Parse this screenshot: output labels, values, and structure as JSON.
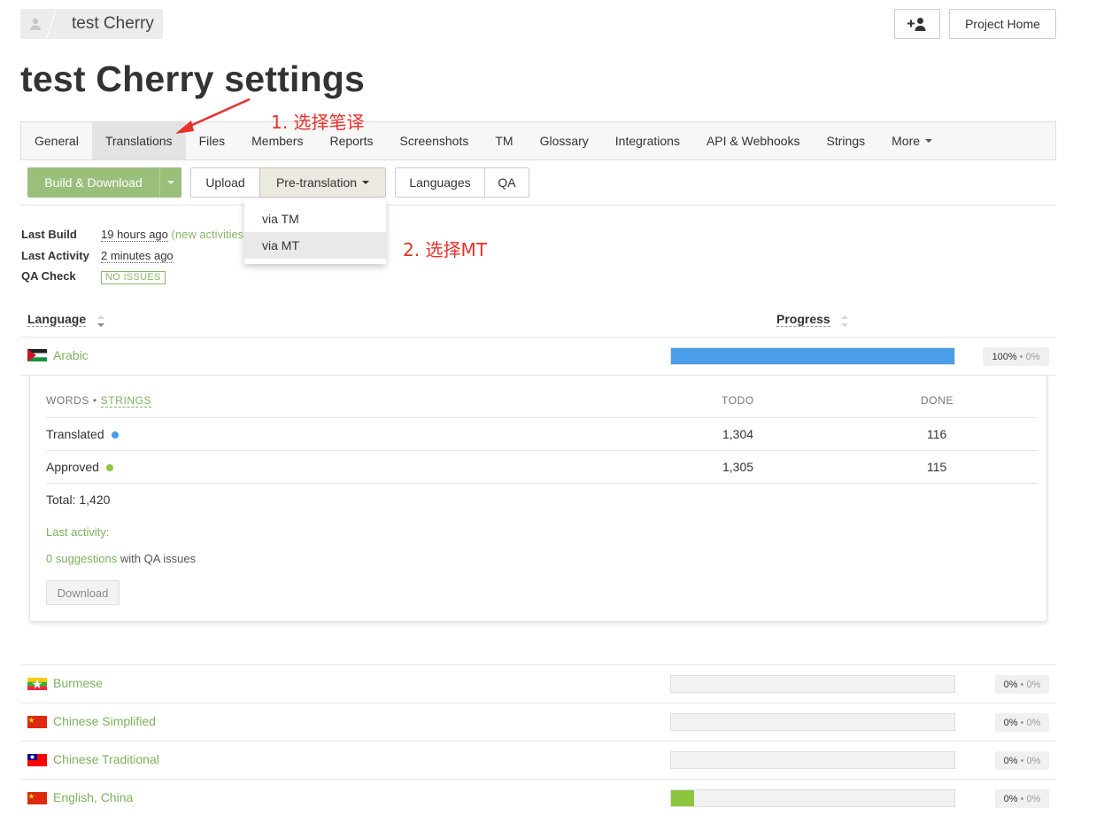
{
  "header": {
    "project_name": "test Cherry",
    "add_member_icon": "add-user-icon",
    "project_home_label": "Project Home"
  },
  "page_title": "test Cherry settings",
  "tabs": [
    {
      "label": "General"
    },
    {
      "label": "Translations",
      "active": true
    },
    {
      "label": "Files"
    },
    {
      "label": "Members"
    },
    {
      "label": "Reports"
    },
    {
      "label": "Screenshots"
    },
    {
      "label": "TM"
    },
    {
      "label": "Glossary"
    },
    {
      "label": "Integrations"
    },
    {
      "label": "API & Webhooks"
    },
    {
      "label": "Strings"
    },
    {
      "label": "More"
    }
  ],
  "toolbar": {
    "build_label": "Build & Download",
    "upload_label": "Upload",
    "pretranslation_label": "Pre-translation",
    "languages_label": "Languages",
    "qa_label": "QA"
  },
  "pretranslation_menu": {
    "items": [
      "via TM",
      "via MT"
    ],
    "hovered": "via MT"
  },
  "annotations": {
    "step1": "1. 选择笔译",
    "step2": "2. 选择MT"
  },
  "meta": {
    "last_build_key": "Last Build",
    "last_build_value": "19 hours ago",
    "last_build_note": "(new activities",
    "last_activity_key": "Last Activity",
    "last_activity_value": "2 minutes ago",
    "qa_check_key": "QA Check",
    "qa_check_value": "NO ISSUES"
  },
  "table": {
    "col_language": "Language",
    "col_progress": "Progress"
  },
  "languages": [
    {
      "name": "Arabic",
      "translated_pct": 100,
      "pct_label": "100%",
      "approved_label": "0%"
    },
    {
      "name": "Burmese",
      "translated_pct": 0,
      "pct_label": "0%",
      "approved_label": "0%"
    },
    {
      "name": "Chinese Simplified",
      "translated_pct": 0,
      "pct_label": "0%",
      "approved_label": "0%"
    },
    {
      "name": "Chinese Traditional",
      "translated_pct": 0,
      "pct_label": "0%",
      "approved_label": "0%"
    },
    {
      "name": "English, China",
      "translated_pct": 8,
      "pct_label": "0%",
      "approved_label": "0%"
    }
  ],
  "detail": {
    "words_label": "WORDS",
    "strings_label": "STRINGS",
    "todo_label": "TODO",
    "done_label": "DONE",
    "rows": [
      {
        "label": "Translated",
        "todo": "1,304",
        "done": "116",
        "color": "#4a9ee8"
      },
      {
        "label": "Approved",
        "todo": "1,305",
        "done": "115",
        "color": "#8cc63f"
      }
    ],
    "total": "Total: 1,420",
    "last_activity": "Last activity:",
    "suggestions_link": "0 suggestions",
    "suggestions_rest": "with QA issues",
    "download_label": "Download"
  },
  "colors": {
    "accent_green": "#7cb15b",
    "progress_blue": "#4a9ee8",
    "progress_green": "#8cc63f",
    "annotation_red": "#e8312a"
  }
}
